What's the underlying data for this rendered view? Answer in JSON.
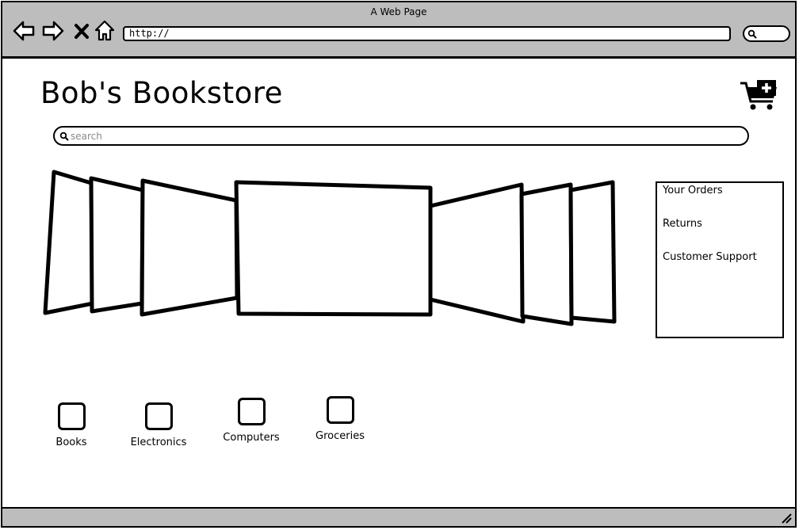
{
  "window": {
    "title": "A Web Page"
  },
  "browser": {
    "url": "http://",
    "nav_icons": [
      "back-arrow-icon",
      "forward-arrow-icon",
      "close-x-icon",
      "home-icon"
    ],
    "search_icon": "search-icon"
  },
  "site": {
    "title": "Bob's Bookstore",
    "cart_icon": "cart-add-icon"
  },
  "search": {
    "placeholder": "search",
    "value": ""
  },
  "side_menu": {
    "items": [
      {
        "label": "Your Orders"
      },
      {
        "label": "Returns"
      },
      {
        "label": "Customer Support"
      }
    ]
  },
  "categories": [
    {
      "label": "Books"
    },
    {
      "label": "Electronics"
    },
    {
      "label": "Computers"
    },
    {
      "label": "Groceries"
    }
  ],
  "colors": {
    "chrome": "#bdbdbd",
    "stroke": "#000000",
    "placeholder": "#8a8a8a"
  }
}
